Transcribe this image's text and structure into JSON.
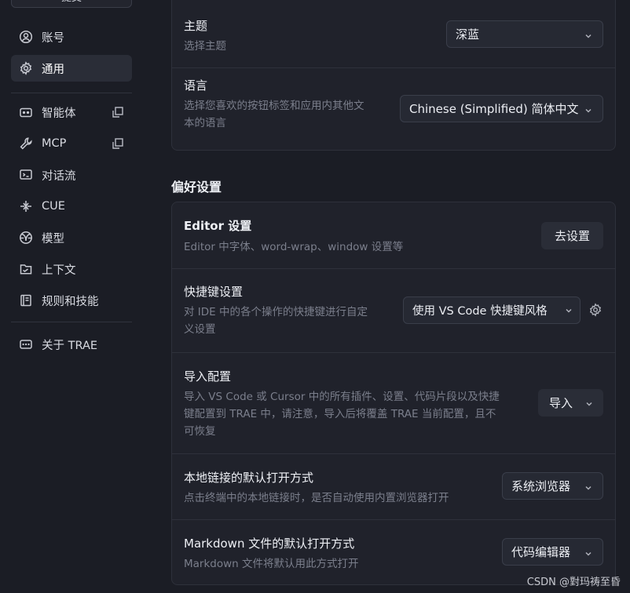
{
  "sidebar": {
    "top_button": "提交",
    "items": [
      {
        "label": "账号",
        "icon": "user-icon"
      },
      {
        "label": "通用",
        "icon": "gear-icon",
        "active": true
      },
      {
        "label": "智能体",
        "icon": "bot-icon",
        "external": true
      },
      {
        "label": "MCP",
        "icon": "wrench-icon",
        "external": true
      },
      {
        "label": "对话流",
        "icon": "terminal-icon"
      },
      {
        "label": "CUE",
        "icon": "cue-icon"
      },
      {
        "label": "模型",
        "icon": "model-icon"
      },
      {
        "label": "上下文",
        "icon": "folder-icon"
      },
      {
        "label": "规则和技能",
        "icon": "book-icon"
      },
      {
        "label": "关于 TRAE",
        "icon": "info-card-icon"
      }
    ]
  },
  "general": {
    "theme": {
      "title": "主题",
      "desc": "选择主题",
      "value": "深蓝"
    },
    "language": {
      "title": "语言",
      "desc_line1": "选择您喜欢的按钮标签和应用内其他文",
      "desc_line2": "本的语言",
      "value": "Chinese (Simplified) 简体中文"
    }
  },
  "preferences": {
    "section_title": "偏好设置",
    "editor": {
      "title": "Editor 设置",
      "desc": "Editor 中字体、word-wrap、window 设置等",
      "button": "去设置"
    },
    "shortcuts": {
      "title": "快捷键设置",
      "desc_line1": "对 IDE 中的各个操作的快捷键进行自定",
      "desc_line2": "义设置",
      "value": "使用 VS Code 快捷键风格"
    },
    "import": {
      "title": "导入配置",
      "desc_line1": "导入 VS Code 或 Cursor 中的所有插件、设置、代码片段以及快捷",
      "desc_line2": "键配置到 TRAE 中，请注意，导入后将覆盖 TRAE 当前配置，且不",
      "desc_line3": "可恢复",
      "button": "导入"
    },
    "local_link": {
      "title": "本地链接的默认打开方式",
      "desc": "点击终端中的本地链接时，是否自动使用内置浏览器打开",
      "value": "系统浏览器"
    },
    "markdown": {
      "title": "Markdown 文件的默认打开方式",
      "desc": "Markdown 文件将默认用此方式打开",
      "value": "代码编辑器"
    }
  },
  "watermark": "CSDN @對玛祷至昏"
}
